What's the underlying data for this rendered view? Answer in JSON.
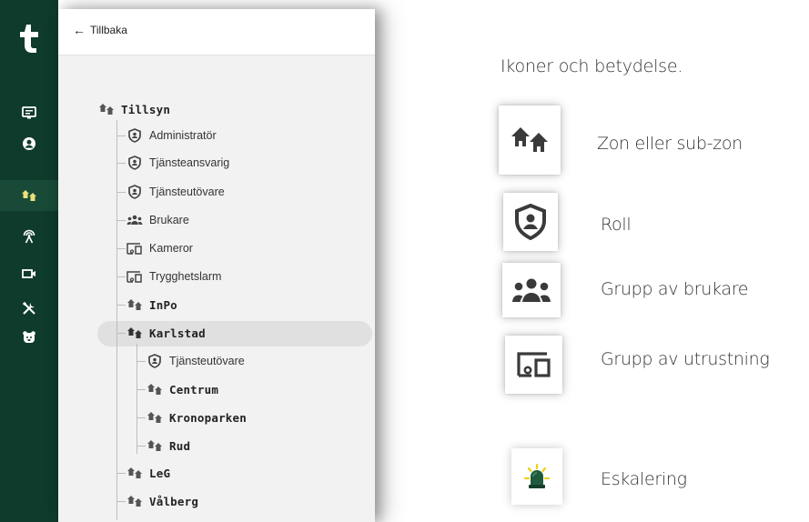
{
  "rail": {
    "logo": "logo-icon",
    "items": [
      {
        "icon": "monitor-icon"
      },
      {
        "icon": "user-icon"
      },
      {
        "icon": "zone-icon",
        "active": true
      },
      {
        "icon": "signal-icon"
      },
      {
        "icon": "camera-icon"
      },
      {
        "icon": "tools-icon"
      },
      {
        "icon": "bear-icon"
      }
    ]
  },
  "panel": {
    "back_label": "Tillbaka",
    "tree": {
      "root": "Tillsyn",
      "nodes": [
        {
          "label": "Administratör",
          "type": "role"
        },
        {
          "label": "Tjänsteansvarig",
          "type": "role"
        },
        {
          "label": "Tjänsteutövare",
          "type": "role"
        },
        {
          "label": "Brukare",
          "type": "group"
        },
        {
          "label": "Kameror",
          "type": "equipment"
        },
        {
          "label": "Trygghetslarm",
          "type": "equipment"
        },
        {
          "label": "InPo",
          "type": "zone"
        },
        {
          "label": "Karlstad",
          "type": "zone",
          "selected": true
        },
        {
          "label": "Tjänsteutövare",
          "type": "role"
        },
        {
          "label": "Centrum",
          "type": "zone"
        },
        {
          "label": "Kronoparken",
          "type": "zone"
        },
        {
          "label": "Rud",
          "type": "zone"
        },
        {
          "label": "LeG",
          "type": "zone"
        },
        {
          "label": "Vålberg",
          "type": "zone"
        }
      ]
    }
  },
  "legend": {
    "title": "Ikoner och betydelse.",
    "items": [
      {
        "icon": "zone-icon",
        "label": "Zon eller sub-zon"
      },
      {
        "icon": "role-shield-icon",
        "label": "Roll"
      },
      {
        "icon": "group-icon",
        "label": "Grupp av brukare"
      },
      {
        "icon": "equipment-icon",
        "label": "Grupp av utrustning"
      },
      {
        "icon": "escalation-icon",
        "label": "Eskalering"
      }
    ]
  },
  "colors": {
    "rail_bg": "#0f3b2c",
    "rail_icon": "#ffffff",
    "rail_active_icon": "#e9e27a",
    "panel_bg": "#f2f2f2",
    "selected_bg": "#e0e0e0",
    "escalation_green": "#1f5a3c",
    "escalation_glow": "#f0d01a"
  }
}
